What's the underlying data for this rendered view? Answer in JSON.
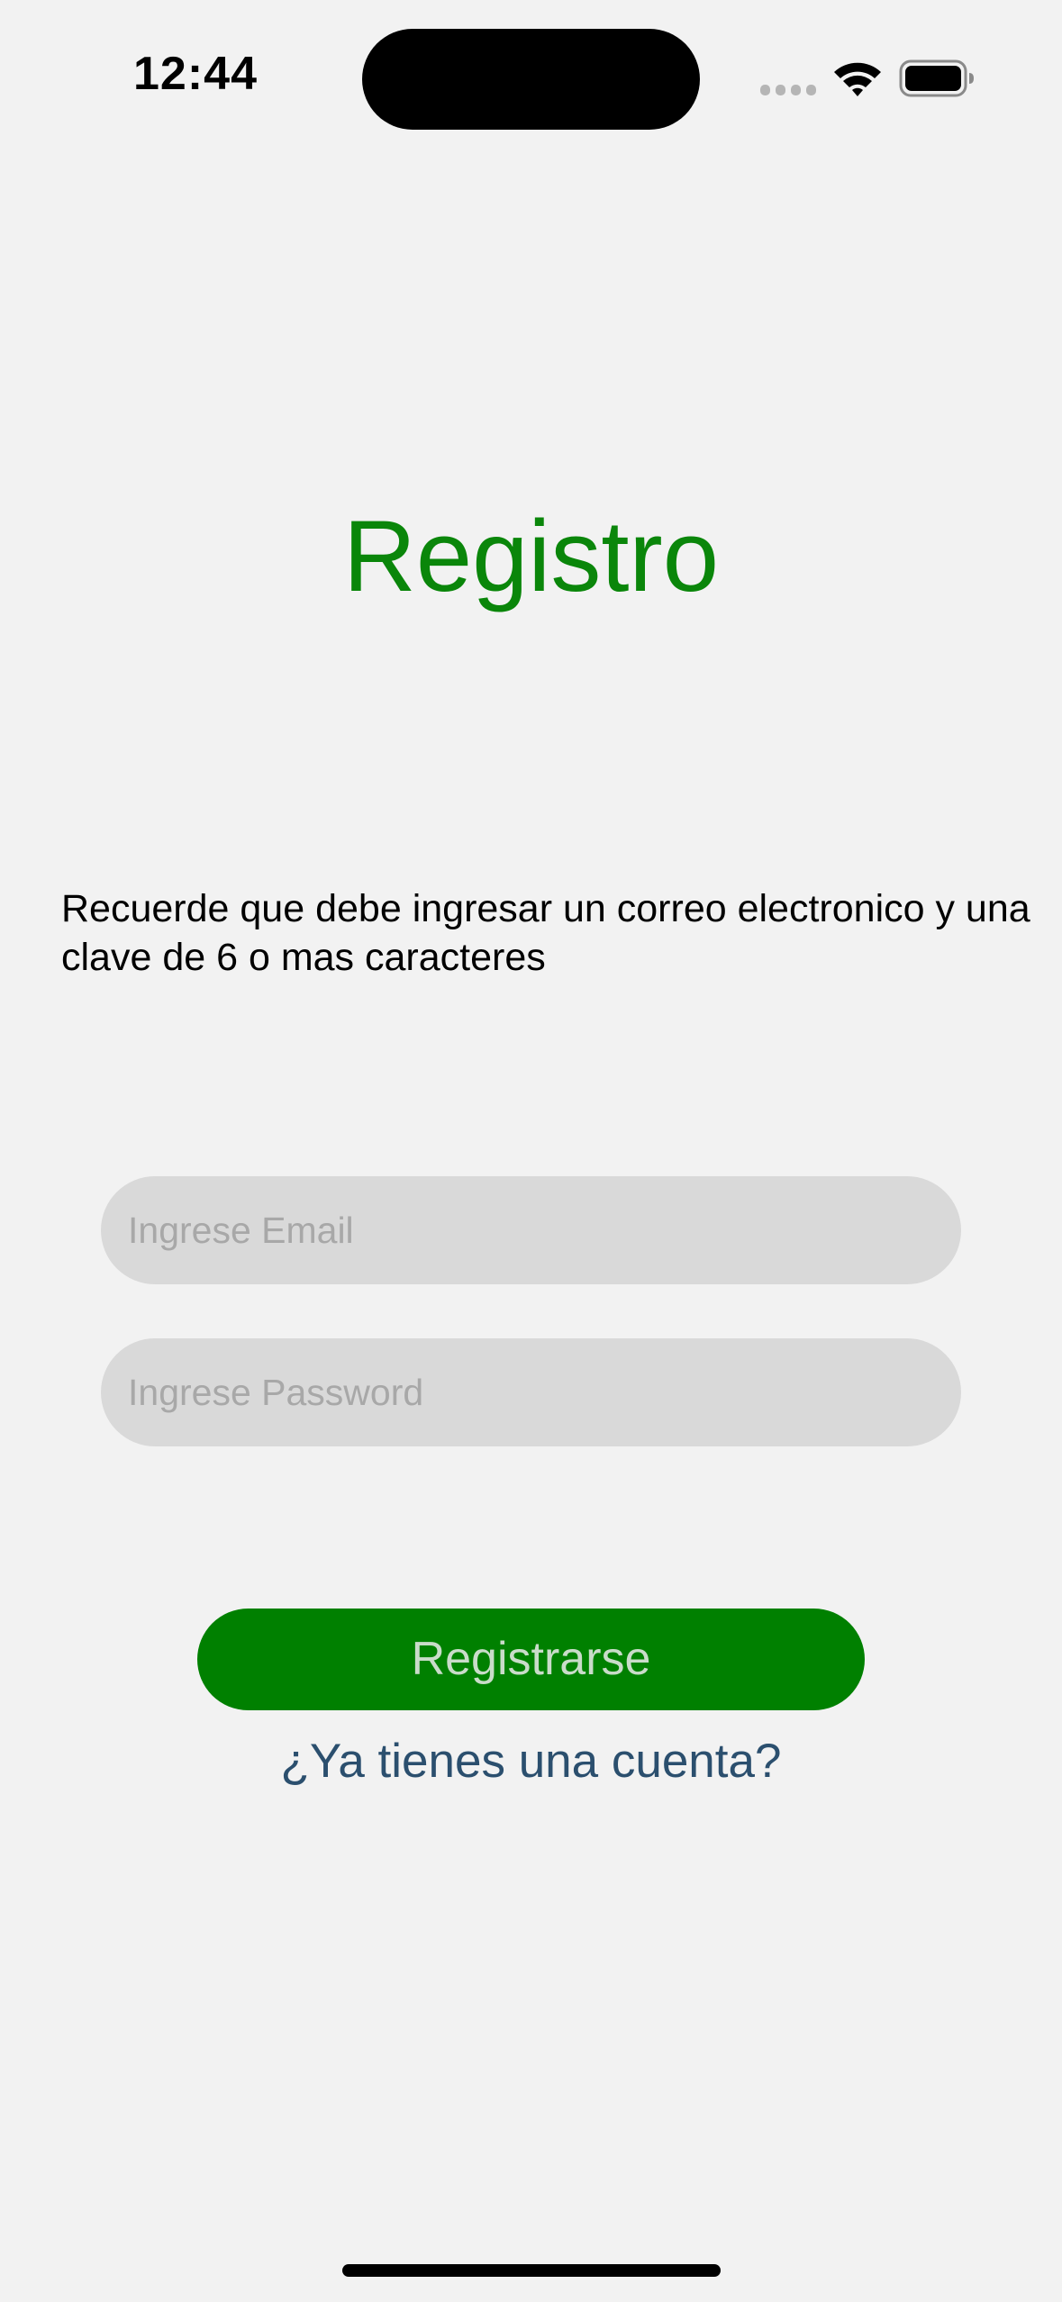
{
  "status_bar": {
    "time": "12:44",
    "icons": [
      "signal-icon",
      "wifi-icon",
      "battery-icon"
    ]
  },
  "title": "Registro",
  "hint": "Recuerde que debe ingresar un correo electronico y una clave de 6 o mas caracteres",
  "form": {
    "email_placeholder": "Ingrese Email",
    "email_value": "",
    "password_placeholder": "Ingrese Password",
    "password_value": ""
  },
  "register_button_label": "Registrarse",
  "login_link_label": "¿Ya tienes una cuenta?",
  "colors": {
    "background": "#f2f2f2",
    "accent_green": "#008000",
    "title_green": "#0a860a",
    "field_background": "#d9d9d9",
    "link_blue": "#2b4f6e"
  }
}
